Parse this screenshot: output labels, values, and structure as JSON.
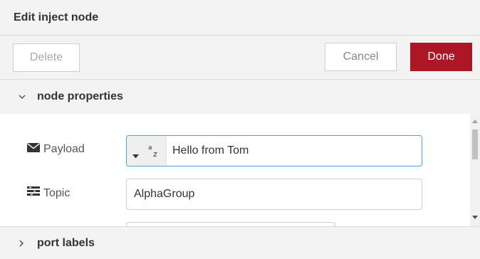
{
  "dialog": {
    "title": "Edit inject node"
  },
  "toolbar": {
    "delete_label": "Delete",
    "cancel_label": "Cancel",
    "done_label": "Done"
  },
  "sections": {
    "properties_label": "node properties",
    "port_labels_label": "port labels"
  },
  "fields": {
    "payload": {
      "label": "Payload",
      "type_icon": "string-type-az-icon",
      "value": "Hello from Tom"
    },
    "topic": {
      "label": "Topic",
      "value": "AlphaGroup"
    }
  },
  "colors": {
    "done_button": "#ad1625",
    "focus_border": "#4aa3e0"
  }
}
